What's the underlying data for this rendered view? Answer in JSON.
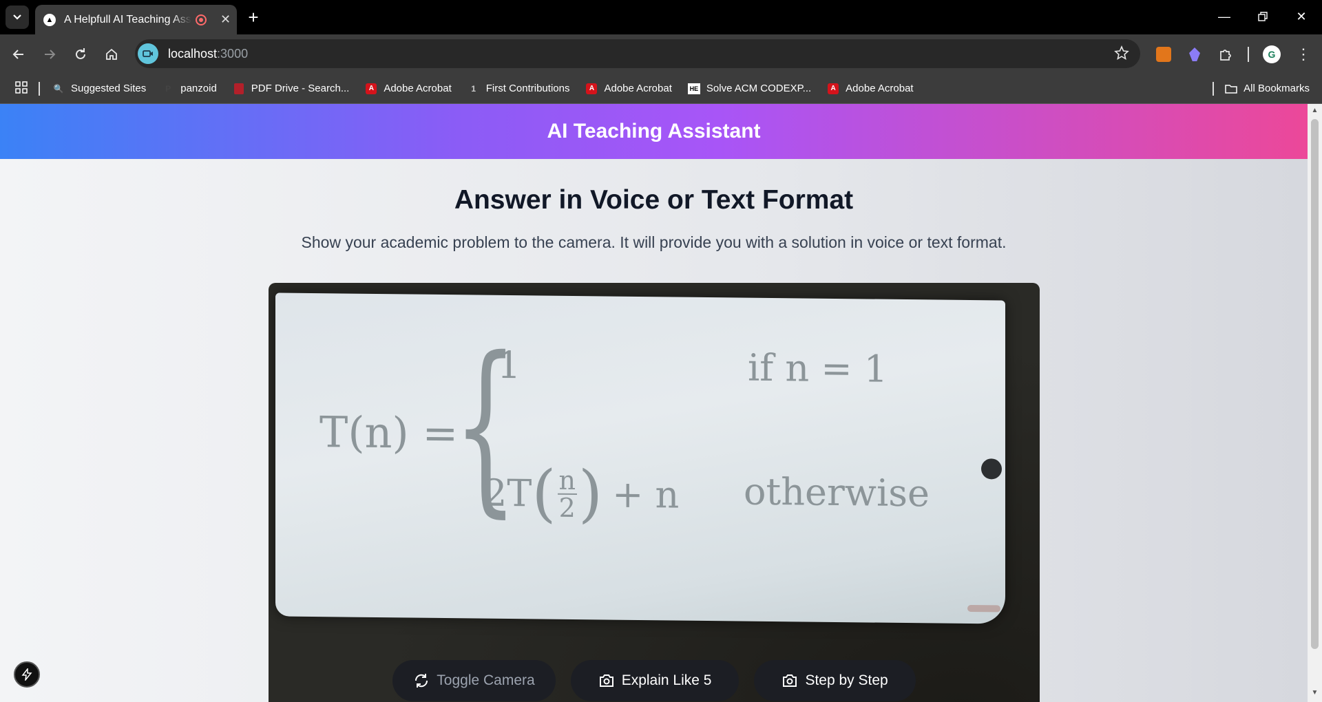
{
  "browser": {
    "tab_title": "A Helpfull AI Teaching Assistant",
    "url_host": "localhost",
    "url_port": ":3000",
    "bookmarks": [
      {
        "label": "Suggested Sites",
        "icon": "search-icon"
      },
      {
        "label": "panzoid",
        "icon": "panzoid-icon"
      },
      {
        "label": "PDF Drive - Search...",
        "icon": "pdf-drive-icon"
      },
      {
        "label": "Adobe Acrobat",
        "icon": "acrobat-icon"
      },
      {
        "label": "First Contributions",
        "icon": "first-contributions-icon"
      },
      {
        "label": "Adobe Acrobat",
        "icon": "acrobat-icon"
      },
      {
        "label": "Solve ACM CODEXP...",
        "icon": "hackerearth-icon"
      },
      {
        "label": "Adobe Acrobat",
        "icon": "acrobat-icon"
      }
    ],
    "all_bookmarks": "All Bookmarks"
  },
  "app": {
    "header_title": "AI Teaching Assistant",
    "page_title": "Answer in Voice or Text Format",
    "page_subtitle": "Show your academic problem to the camera. It will provide you with a solution in voice or text format.",
    "equation": {
      "lhs": "T(n) =",
      "case1_value": "1",
      "case1_condition": "if n = 1",
      "case2_prefix": "2T",
      "case2_num": "n",
      "case2_den": "2",
      "case2_suffix": "+ n",
      "case2_condition": "otherwise"
    },
    "controls": {
      "toggle_camera": "Toggle Camera",
      "explain_like_5": "Explain Like 5",
      "step_by_step": "Step by Step"
    }
  },
  "colors": {
    "header_gradient_start": "#3b82f6",
    "header_gradient_mid": "#a855f7",
    "header_gradient_end": "#ec4899",
    "button_bg": "#1c1e24"
  }
}
